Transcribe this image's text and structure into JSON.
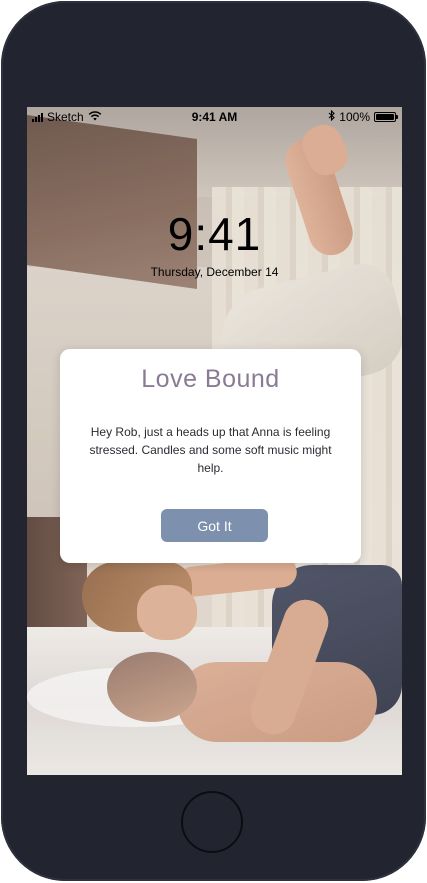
{
  "status_bar": {
    "carrier": "Sketch",
    "time": "9:41 AM",
    "battery_percent": "100%",
    "icons": [
      "signal-bars-icon",
      "wifi-icon",
      "bluetooth-icon",
      "battery-icon"
    ]
  },
  "lock_screen": {
    "time": "9:41",
    "date": "Thursday, December 14"
  },
  "notification": {
    "title": "Love Bound",
    "body": "Hey Rob, just a heads up that Anna is feeling stressed. Candles and some soft music might help.",
    "button_label": "Got It"
  },
  "colors": {
    "phone_frame": "#222530",
    "title": "#8a7b95",
    "button": "#7d90ad"
  }
}
